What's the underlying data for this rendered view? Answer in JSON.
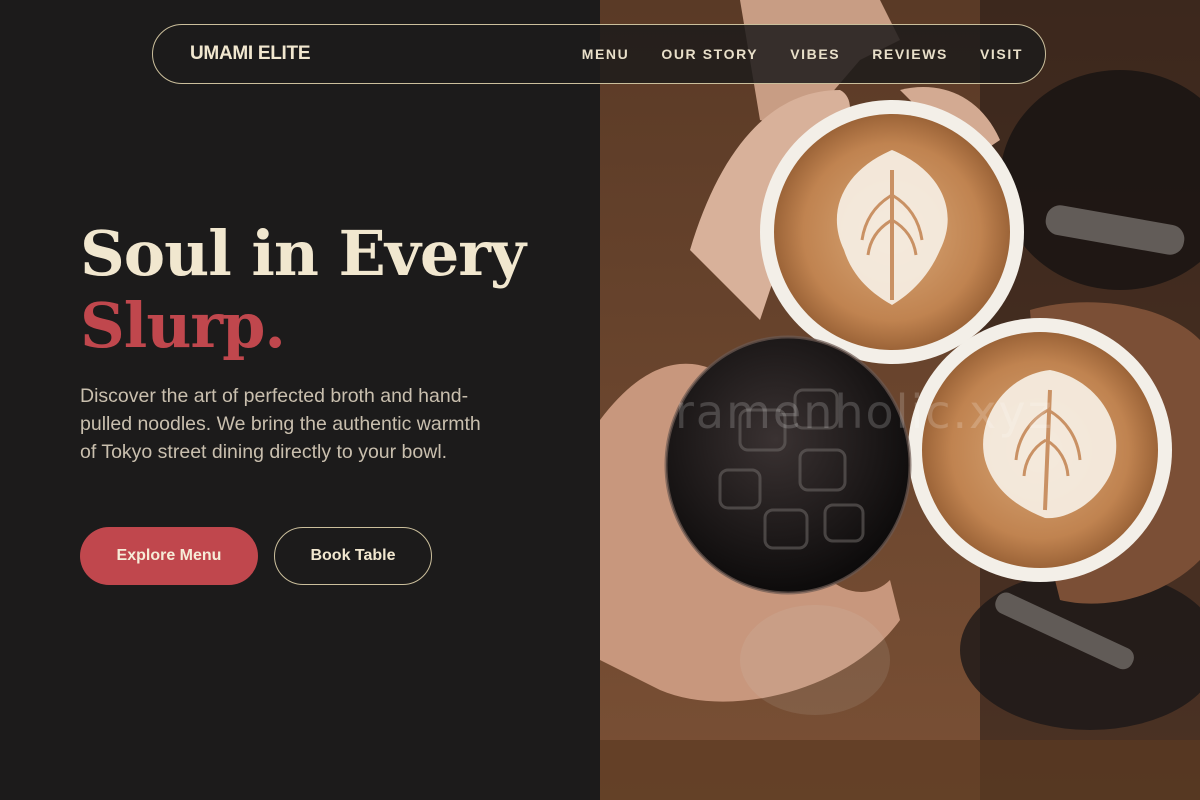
{
  "nav": {
    "brand": "UMAMI ELITE",
    "links": [
      "MENU",
      "OUR STORY",
      "VIBES",
      "REVIEWS",
      "VISIT"
    ]
  },
  "hero": {
    "title_line1": "Soul in Every",
    "title_line2": "Slurp.",
    "description": "Discover the art of perfected broth and hand-pulled noodles. We bring the authentic warmth of Tokyo street dining directly to your bowl.",
    "primary_button": "Explore Menu",
    "secondary_button": "Book Table"
  },
  "image": {
    "watermark": "ramenholic.xyz",
    "alt": "coffee-toast-photo"
  },
  "colors": {
    "background": "#1c1b1b",
    "cream": "#f1e7cf",
    "accent": "#c0474d",
    "border": "#cbbf9c"
  }
}
